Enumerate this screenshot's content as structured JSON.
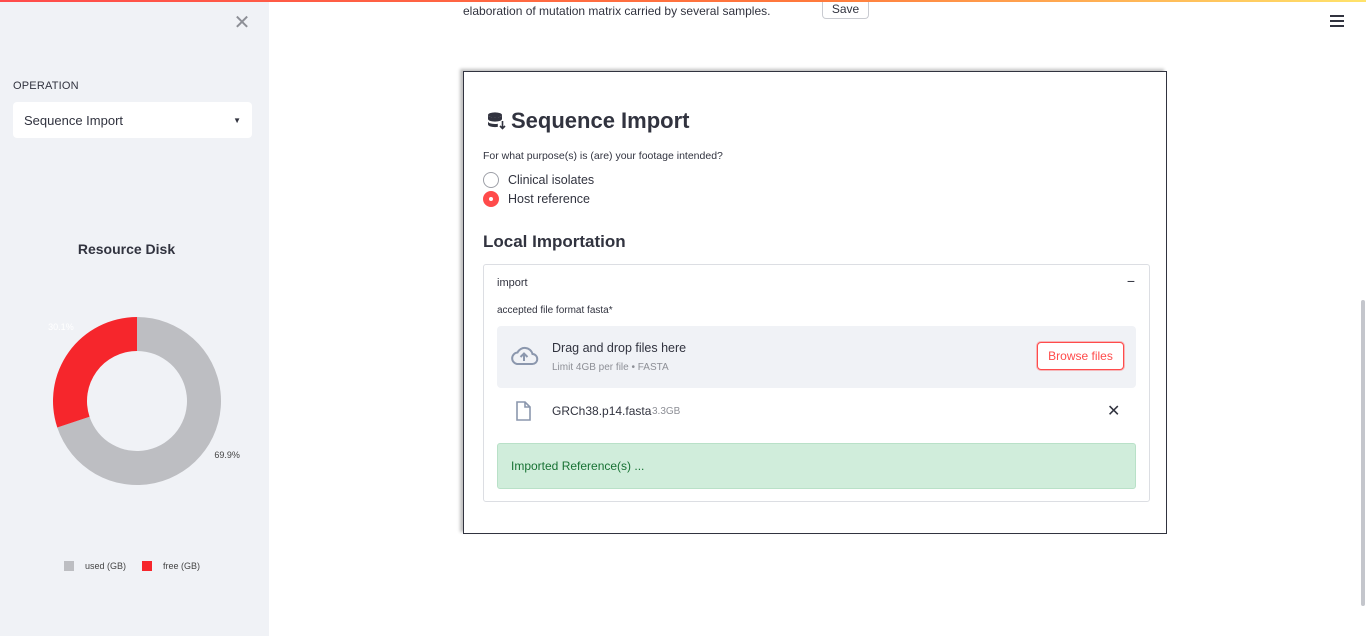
{
  "sidebar": {
    "close_glyph": "✕",
    "operation_label": "OPERATION",
    "operation_selected": "Sequence Import",
    "chart_title": "Resource Disk"
  },
  "chart_data": {
    "type": "pie",
    "title": "Resource Disk",
    "categories": [
      "used (GB)",
      "free (GB)"
    ],
    "values": [
      69.9,
      30.1
    ],
    "labels": [
      "69.9%",
      "30.1%"
    ],
    "colors": [
      "#bdbec2",
      "#f6262c"
    ],
    "donut": true,
    "legend": "bottom"
  },
  "main": {
    "intro_text": "elaboration of mutation matrix carried by several samples.",
    "save_label": "Save",
    "panel": {
      "title": "Sequence Import",
      "question": "For what purpose(s) is (are) your footage intended?",
      "options": [
        {
          "label": "Clinical isolates",
          "checked": false
        },
        {
          "label": "Host reference",
          "checked": true
        }
      ],
      "section_title": "Local Importation",
      "expander": {
        "label": "import",
        "toggle": "−",
        "accepted": "accepted file format fasta*",
        "dropzone_title": "Drag and drop files here",
        "dropzone_sub": "Limit 4GB per file • FASTA",
        "browse_label": "Browse files",
        "file_name": "GRCh38.p14.fasta",
        "file_size": "3.3GB",
        "remove_glyph": "✕",
        "success": "Imported Reference(s) ..."
      }
    }
  },
  "colors": {
    "accent": "#ff4b4b",
    "sidebar_bg": "#f0f2f6",
    "success_bg": "#d0eddb",
    "success_text": "#177233"
  }
}
